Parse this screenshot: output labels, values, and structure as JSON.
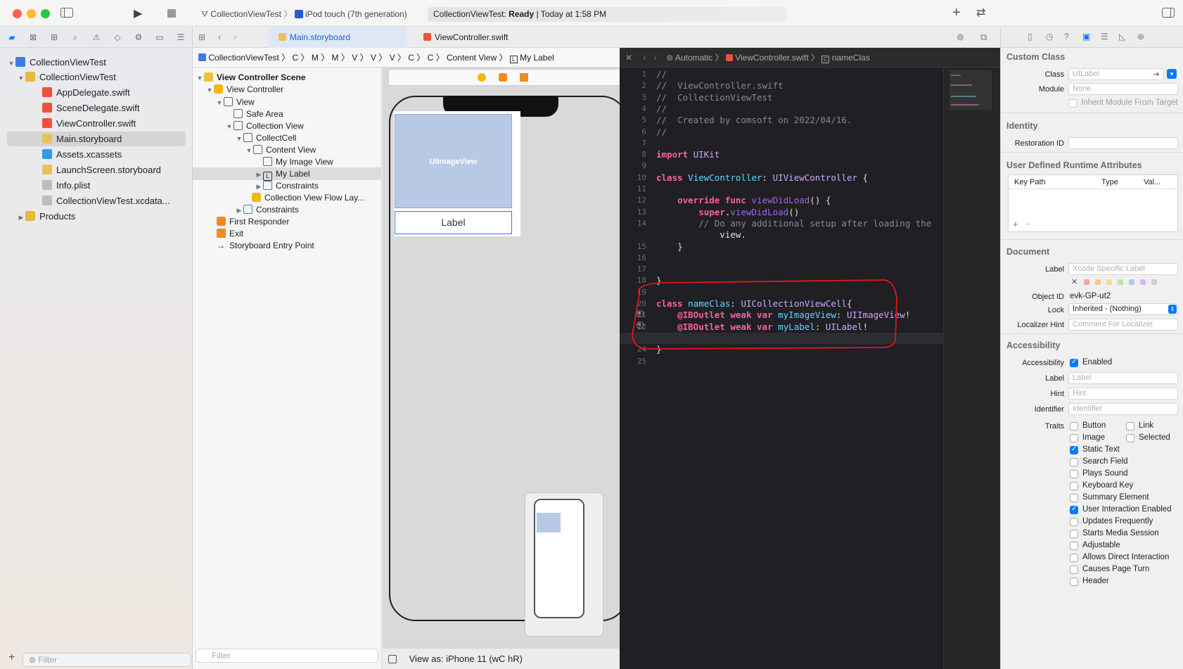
{
  "toolbar": {
    "scheme": "CollectionViewTest",
    "destination": "iPod touch (7th generation)",
    "status_app": "CollectionViewTest:",
    "status_state": "Ready",
    "status_time": "Today at 1:58 PM"
  },
  "navigator": {
    "items": [
      {
        "label": "CollectionViewTest"
      },
      {
        "label": "CollectionViewTest"
      },
      {
        "label": "AppDelegate.swift"
      },
      {
        "label": "SceneDelegate.swift"
      },
      {
        "label": "ViewController.swift"
      },
      {
        "label": "Main.storyboard"
      },
      {
        "label": "Assets.xcassets"
      },
      {
        "label": "LaunchScreen.storyboard"
      },
      {
        "label": "Info.plist"
      },
      {
        "label": "CollectionViewTest.xcdata..."
      },
      {
        "label": "Products"
      }
    ],
    "filter_placeholder": "Filter"
  },
  "tabs": [
    {
      "label": "Main.storyboard"
    },
    {
      "label": "ViewController.swift"
    }
  ],
  "jumpbar_left": {
    "items": [
      "CollectionViewTest",
      "C",
      "M",
      "M",
      "V",
      "V",
      "V",
      "C",
      "C",
      "Content View",
      "My Label"
    ]
  },
  "jumpbar_right": {
    "mode": "Automatic",
    "file": "ViewController.swift",
    "symbol": "nameClas"
  },
  "outline": {
    "rows": [
      {
        "label": "View Controller Scene"
      },
      {
        "label": "View Controller"
      },
      {
        "label": "View"
      },
      {
        "label": "Safe Area"
      },
      {
        "label": "Collection View"
      },
      {
        "label": "CollectCell"
      },
      {
        "label": "Content View"
      },
      {
        "label": "My Image View"
      },
      {
        "label": "My Label"
      },
      {
        "label": "Constraints"
      },
      {
        "label": "Collection View Flow Lay..."
      },
      {
        "label": "Constraints"
      },
      {
        "label": "First Responder"
      },
      {
        "label": "Exit"
      },
      {
        "label": "Storyboard Entry Point"
      }
    ],
    "filter_placeholder": "Filter"
  },
  "canvas": {
    "image_view_label": "UIImageView",
    "label_text": "Label",
    "view_as": "View as: iPhone 11 (wC hR)"
  },
  "code": {
    "line_numbers": [
      "1",
      "2",
      "3",
      "4",
      "5",
      "6",
      "7",
      "8",
      "9",
      "10",
      "11",
      "12",
      "13",
      "14",
      "",
      "15",
      "16",
      "17",
      "18",
      "19",
      "20",
      "21",
      "22",
      "23",
      "24",
      "25"
    ],
    "lines": [
      "//",
      "//  ViewController.swift",
      "//  CollectionViewTest",
      "//",
      "//  Created by comsoft on 2022/04/16.",
      "//",
      "",
      "import UIKit",
      "",
      "class ViewController: UIViewController {",
      "",
      "    override func viewDidLoad() {",
      "        super.viewDidLoad()",
      "        // Do any additional setup after loading the",
      "            view.",
      "    }",
      "",
      "",
      "}",
      "",
      "class nameClas: UICollectionViewCell{",
      "    @IBOutlet weak var myImageView: UIImageView!",
      "    @IBOutlet weak var myLabel: UILabel!",
      "",
      "}",
      ""
    ],
    "highlight_color": "#e0161b"
  },
  "inspector": {
    "custom_class_header": "Custom Class",
    "class_label": "Class",
    "class_placeholder": "UILabel",
    "module_label": "Module",
    "module_placeholder": "None",
    "inherit_label": "Inherit Module From Target",
    "identity_header": "Identity",
    "restoration_label": "Restoration ID",
    "udra_header": "User Defined Runtime Attributes",
    "col_keypath": "Key Path",
    "col_type": "Type",
    "col_value": "Val...",
    "document_header": "Document",
    "doc_label": "Label",
    "doc_label_placeholder": "Xcode Specific Label",
    "object_id_label": "Object ID",
    "object_id": "evk-GP-ut2",
    "lock_label": "Lock",
    "lock_value": "Inherited - (Nothing)",
    "localizer_label": "Localizer Hint",
    "localizer_placeholder": "Comment For Localizer",
    "accessibility_header": "Accessibility",
    "acc_label": "Accessibility",
    "acc_enabled": "Enabled",
    "acc_label2": "Label",
    "acc_label2_placeholder": "Label",
    "hint_label": "Hint",
    "hint_placeholder": "Hint",
    "identifier_label": "Identifier",
    "identifier_placeholder": "Identifier",
    "traits_label": "Traits",
    "traits": [
      {
        "label": "Button",
        "checked": false
      },
      {
        "label": "Link",
        "checked": false
      },
      {
        "label": "Image",
        "checked": false
      },
      {
        "label": "Selected",
        "checked": false
      },
      {
        "label": "Static Text",
        "checked": true
      },
      {
        "label": "Search Field",
        "checked": false
      },
      {
        "label": "Plays Sound",
        "checked": false
      },
      {
        "label": "Keyboard Key",
        "checked": false
      },
      {
        "label": "Summary Element",
        "checked": false
      },
      {
        "label": "User Interaction Enabled",
        "checked": true
      },
      {
        "label": "Updates Frequently",
        "checked": false
      },
      {
        "label": "Starts Media Session",
        "checked": false
      },
      {
        "label": "Adjustable",
        "checked": false
      },
      {
        "label": "Allows Direct Interaction",
        "checked": false
      },
      {
        "label": "Causes Page Turn",
        "checked": false
      },
      {
        "label": "Header",
        "checked": false
      }
    ]
  },
  "colors": {
    "accent": "#0a7aff",
    "red_window_button": "#ff5f57",
    "yellow_window_button": "#febc2e",
    "green_window_button": "#28c840"
  }
}
